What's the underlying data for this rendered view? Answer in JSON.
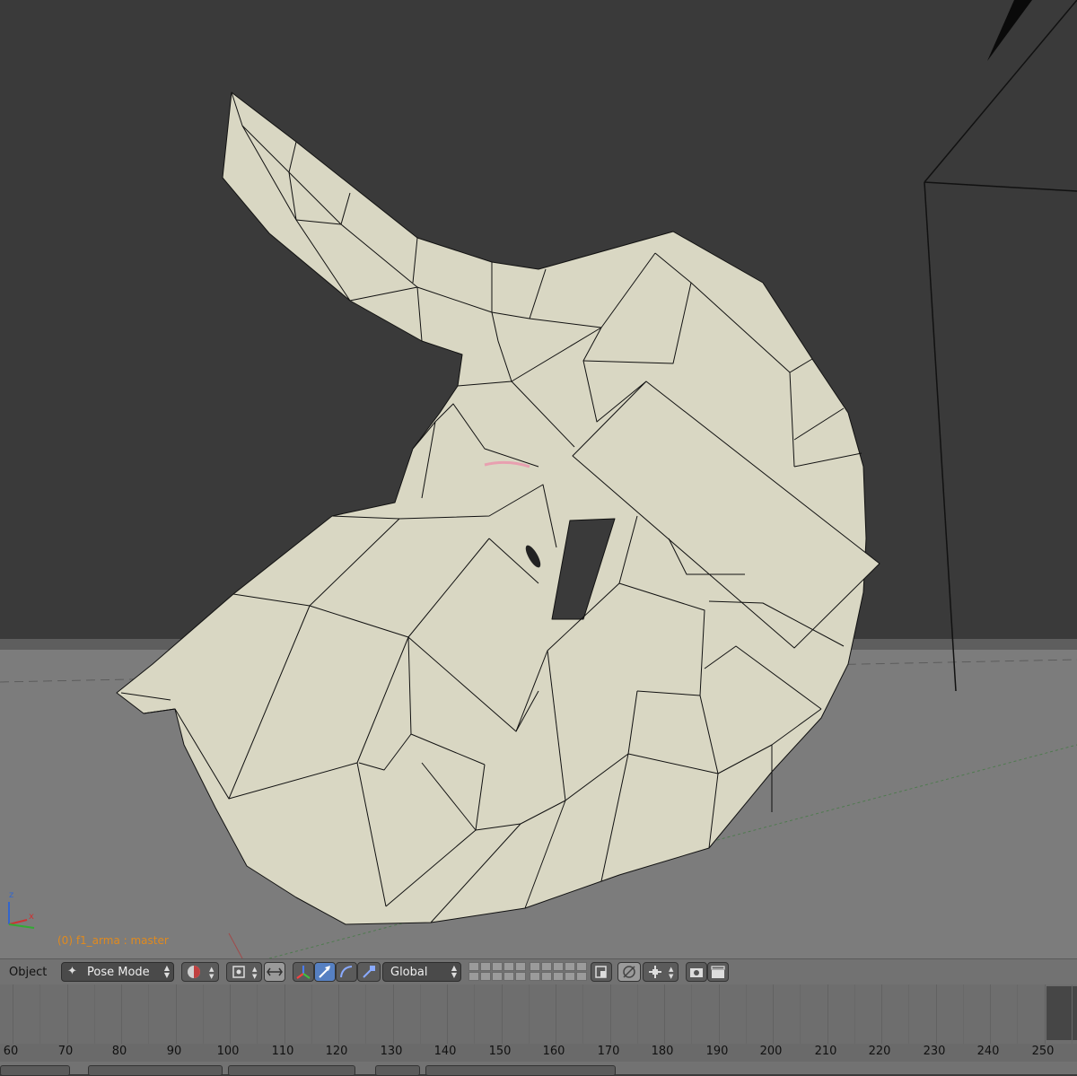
{
  "viewport": {
    "object_label": "(0) f1_arma : master"
  },
  "header": {
    "object_menu": "Object",
    "mode": "Pose Mode",
    "orientation": "Global"
  },
  "timeline": {
    "frames": [
      "60",
      "70",
      "80",
      "90",
      "100",
      "110",
      "120",
      "130",
      "140",
      "150",
      "160",
      "170",
      "180",
      "190",
      "200",
      "210",
      "220",
      "230",
      "240",
      "250"
    ]
  },
  "icons": {
    "mode": "pose-mode-icon",
    "shading": "viewport-shading-icon",
    "pivot": "pivot-point-icon",
    "manipulator": "manipulator-icon",
    "translate": "translate-icon",
    "rotate": "rotate-icon",
    "scale": "scale-icon",
    "proportional": "proportional-edit-icon",
    "snap": "snap-magnet-icon",
    "snap_element": "snap-element-icon",
    "render": "render-still-icon",
    "anim": "render-animation-icon"
  },
  "colors": {
    "mesh_fill": "#d9d7c3",
    "background": "#3a3a3a",
    "floor": "#7a7a7a",
    "active_button": "#5680c2",
    "object_label": "#e08a1e"
  }
}
